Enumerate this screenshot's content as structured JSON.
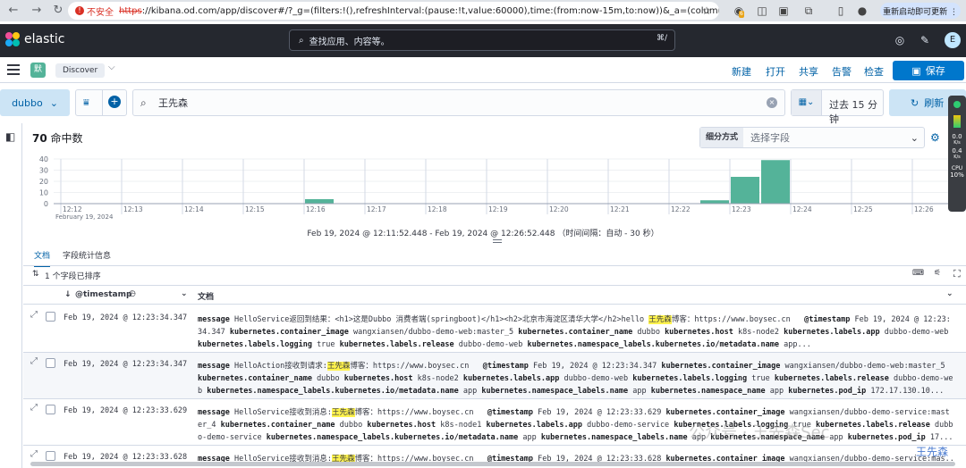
{
  "browser": {
    "warning_label": "不安全",
    "url_scheme": "https",
    "url_rest": "://kibana.od.com/app/discover#/?_g=(filters:!(),refreshInterval:(pause:!t,value:60000),time:(from:now-15m,to:now))&_a=(column...",
    "update_button": "重新启动即可更新 ⋮",
    "ext_badge": "6"
  },
  "header": {
    "brand": "elastic",
    "search_placeholder": "查找应用、内容等。",
    "search_shortcut": "⌘/",
    "avatar_letter": "E"
  },
  "appnav": {
    "space_letter": "默",
    "breadcrumb": "Discover",
    "links": [
      "新建",
      "打开",
      "共享",
      "告警",
      "检查"
    ],
    "save_label": "保存"
  },
  "query": {
    "data_view": "dubbo",
    "query_text": "王先森",
    "time_label": "过去 15 分钟",
    "refresh_label": "刷新"
  },
  "side_widget": {
    "line1": "0.0",
    "line2": "K/s",
    "line3": "0.4",
    "line4": "K/s",
    "line5": "CPU",
    "line6": "10%"
  },
  "hits": {
    "count": "70",
    "label": "命中数"
  },
  "breakdown": {
    "label": "细分方式",
    "placeholder": "选择字段"
  },
  "chart_data": {
    "type": "bar",
    "y_ticks": [
      "40",
      "30",
      "20",
      "10",
      "0"
    ],
    "ylim": [
      0,
      40
    ],
    "x_ticks": [
      "12:12",
      "12:13",
      "12:14",
      "12:15",
      "12:16",
      "12:17",
      "12:18",
      "12:19",
      "12:20",
      "12:21",
      "12:22",
      "12:23",
      "12:24",
      "12:25",
      "12:26"
    ],
    "x_subtitle": "February 19, 2024",
    "bars": [
      {
        "start": "12:16:00",
        "value": 4
      },
      {
        "start": "12:22:30",
        "value": 3
      },
      {
        "start": "12:23:00",
        "value": 24
      },
      {
        "start": "12:23:30",
        "value": 39
      }
    ],
    "bar_color": "#54b399",
    "footer": "Feb 19, 2024 @ 12:11:52.448 - Feb 19, 2024 @ 12:26:52.448 （时间间隔：自动 - 30 秒）"
  },
  "table": {
    "tabs": [
      "文档",
      "字段统计信息"
    ],
    "sort_label": "1 个字段已排序",
    "col_timestamp": "@timestamp",
    "col_document": "文档",
    "rows": [
      {
        "ts": "Feb 19, 2024 @ 12:23:34.347",
        "msg_pre": "HelloService返回到结果：<h1>这是Dubbo 消费者端(springboot)</h1><h2>北京市海淀区清华大学</h2>hello ",
        "msg_hl": "王先森",
        "msg_post": "博客：https://www.boysec.cn",
        "f1k": "@timestamp",
        "f1v": "Feb 19, 2024 @ 12:23:34.347",
        "f2k": "kubernetes.container_image",
        "f2v": "wangxiansen/dubbo-demo-web:master_5",
        "f3k": "kubernetes.container_name",
        "f3v": "dubbo",
        "f4k": "kubernetes.host",
        "f4v": "k8s-node2",
        "f5k": "kubernetes.labels.app",
        "f5v": "dubbo-demo-web",
        "f6k": "kubernetes.labels.logging",
        "f6v": "true",
        "f7k": "kubernetes.labels.release",
        "f7v": "dubbo-demo-web",
        "f8k": "kubernetes.namespace_labels.kubernetes.io/metadata.name",
        "f8v": "app..."
      },
      {
        "ts": "Feb 19, 2024 @ 12:23:34.347",
        "msg_pre": "HelloAction接收到请求:",
        "msg_hl": "王先森",
        "msg_post": "博客：https://www.boysec.cn",
        "f1k": "@timestamp",
        "f1v": "Feb 19, 2024 @ 12:23:34.347",
        "f2k": "kubernetes.container_image",
        "f2v": "wangxiansen/dubbo-demo-web:master_5",
        "f3k": "kubernetes.container_name",
        "f3v": "dubbo",
        "f4k": "kubernetes.host",
        "f4v": "k8s-node2",
        "f5k": "kubernetes.labels.app",
        "f5v": "dubbo-demo-web",
        "f6k": "kubernetes.labels.logging",
        "f6v": "true",
        "f7k": "kubernetes.labels.release",
        "f7v": "dubbo-demo-web",
        "f8k": "kubernetes.namespace_labels.kubernetes.io/metadata.name",
        "f8v": "app",
        "f9k": "kubernetes.namespace_labels.name",
        "f9v": "app",
        "f10k": "kubernetes.namespace_name",
        "f10v": "app",
        "f11k": "kubernetes.pod_ip",
        "f11v": "172.17.130.10..."
      },
      {
        "ts": "Feb 19, 2024 @ 12:23:33.629",
        "msg_pre": "HelloService接收到消息:",
        "msg_hl": "王先森",
        "msg_post": "博客：https://www.boysec.cn",
        "f1k": "@timestamp",
        "f1v": "Feb 19, 2024 @ 12:23:33.629",
        "f2k": "kubernetes.container_image",
        "f2v": "wangxiansen/dubbo-demo-service:master_4",
        "f3k": "kubernetes.container_name",
        "f3v": "dubbo",
        "f4k": "kubernetes.host",
        "f4v": "k8s-node1",
        "f5k": "kubernetes.labels.app",
        "f5v": "dubbo-demo-service",
        "f6k": "kubernetes.labels.logging",
        "f6v": "true",
        "f7k": "kubernetes.labels.release",
        "f7v": "dubbo-demo-service",
        "f8k": "kubernetes.namespace_labels.kubernetes.io/metadata.name",
        "f8v": "app",
        "f9k": "kubernetes.namespace_labels.name",
        "f9v": "app",
        "f10k": "kubernetes.namespace_name",
        "f10v": "app",
        "f11k": "kubernetes.pod_ip",
        "f11v": "17..."
      },
      {
        "ts": "Feb 19, 2024 @ 12:23:33.628",
        "msg_pre": "HelloService接收到消息:",
        "msg_hl": "王先森",
        "msg_post": "博客：https://www.boysec.cn",
        "f1k": "@timestamp",
        "f1v": "Feb 19, 2024 @ 12:23:33.628",
        "f2k": "kubernetes.container_image",
        "f2v": "wangxiansen/dubbo-demo-service:mas..."
      }
    ]
  },
  "watermark": {
    "text": "公众号 · 王先森Sec",
    "corner": "王先森"
  }
}
